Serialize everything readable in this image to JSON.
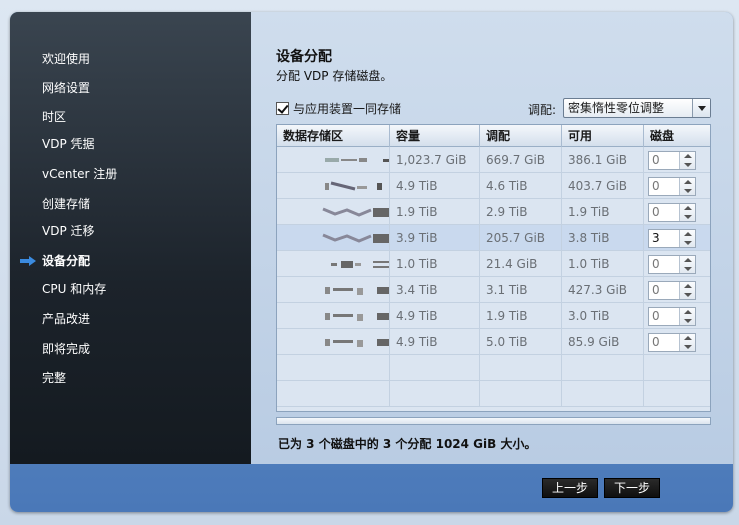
{
  "sidebar": {
    "items": [
      {
        "label": "欢迎使用",
        "active": false
      },
      {
        "label": "网络设置",
        "active": false
      },
      {
        "label": "时区",
        "active": false
      },
      {
        "label": "VDP 凭据",
        "active": false
      },
      {
        "label": "vCenter 注册",
        "active": false
      },
      {
        "label": "创建存储",
        "active": false
      },
      {
        "label": "VDP 迁移",
        "active": false
      },
      {
        "label": "设备分配",
        "active": true
      },
      {
        "label": "CPU 和内存",
        "active": false
      },
      {
        "label": "产品改进",
        "active": false
      },
      {
        "label": "即将完成",
        "active": false
      },
      {
        "label": "完整",
        "active": false
      }
    ]
  },
  "main": {
    "title": "设备分配",
    "subtitle": "分配 VDP 存储磁盘。",
    "store_with_appliance": {
      "label": "与应用装置一同存储",
      "checked": true
    },
    "tuning": {
      "label": "调配:",
      "value": "密集惰性零位调整"
    },
    "table": {
      "columns": [
        "数据存储区",
        "容量",
        "调配",
        "可用",
        "磁盘"
      ],
      "rows": [
        {
          "capacity": "1,023.7 GiB",
          "provisioned": "669.7 GiB",
          "free": "386.1 GiB",
          "disks": "0",
          "selected": false
        },
        {
          "capacity": "4.9 TiB",
          "provisioned": "4.6 TiB",
          "free": "403.7 GiB",
          "disks": "0",
          "selected": false
        },
        {
          "capacity": "1.9 TiB",
          "provisioned": "2.9 TiB",
          "free": "1.9 TiB",
          "disks": "0",
          "selected": false
        },
        {
          "capacity": "3.9 TiB",
          "provisioned": "205.7 GiB",
          "free": "3.8 TiB",
          "disks": "3",
          "selected": true
        },
        {
          "capacity": "1.0 TiB",
          "provisioned": "21.4 GiB",
          "free": "1.0 TiB",
          "disks": "0",
          "selected": false
        },
        {
          "capacity": "3.4 TiB",
          "provisioned": "3.1 TiB",
          "free": "427.3 GiB",
          "disks": "0",
          "selected": false
        },
        {
          "capacity": "4.9 TiB",
          "provisioned": "1.9 TiB",
          "free": "3.0 TiB",
          "disks": "0",
          "selected": false
        },
        {
          "capacity": "4.9 TiB",
          "provisioned": "5.0 TiB",
          "free": "85.9 GiB",
          "disks": "0",
          "selected": false
        }
      ]
    },
    "summary": "已为 3 个磁盘中的 3 个分配 1024 GiB 大小。"
  },
  "footer": {
    "back_label": "上一步",
    "next_label": "下一步"
  },
  "colors": {
    "sidebar_bg": "#1c232b",
    "content_bg": "#c5d5e8",
    "window_frame": "#5a88c6",
    "active_arrow": "#3b8be0"
  }
}
